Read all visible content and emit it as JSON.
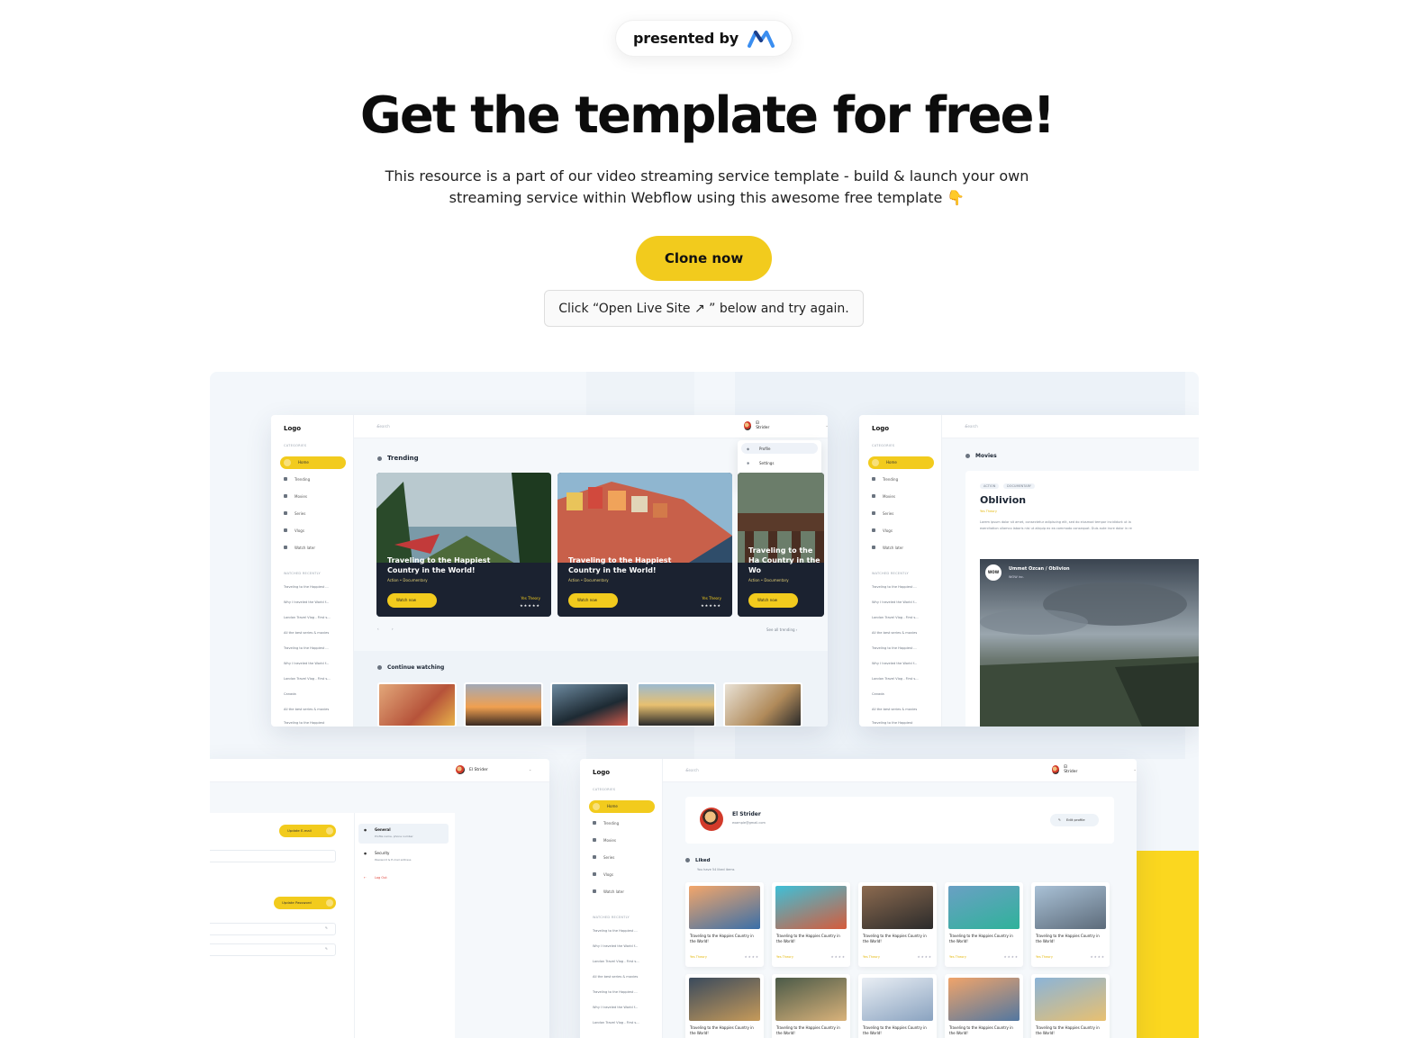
{
  "hero": {
    "presented_by": "presented by",
    "headline": "Get the template for free!",
    "subtext": "This resource is a part of our video streaming service template - build & launch your own streaming service within Webflow using this awesome free template 👇",
    "clone_button": "Clone now",
    "hint": "Click “Open Live Site ↗ ” below and try again."
  },
  "colors": {
    "accent": "#f2cb1d",
    "yellow_block": "#fbd71f",
    "dark_card": "#1b2230"
  },
  "app": {
    "logo": "Logo",
    "search": "Search",
    "categories_label": "CATEGORIES",
    "nav": [
      "Home",
      "Trending",
      "Movies",
      "Series",
      "Vlogs",
      "Watch later"
    ],
    "watched_label": "WATCHED RECENTLY",
    "recent": [
      "Traveling to the Happiest ...",
      "Why I traveled the World f...",
      "London Travel Vlog - First s...",
      "All the best series & movies",
      "Traveling to the Happiest ...",
      "Why I traveled the World f...",
      "London Travel Vlog - First s...",
      "Canada",
      "All the best series & movies",
      "Traveling to the Happiest"
    ],
    "user": "El Strider",
    "user_menu": [
      "Profile",
      "Settings",
      "Log Out"
    ]
  },
  "screen_trending": {
    "section": "Trending",
    "cards": [
      {
        "title": "Traveling to the Happiest Country in the World!",
        "meta": "Action • Documentary",
        "button": "Watch now",
        "channel": "Yes Theory",
        "stars": "★★★★★"
      },
      {
        "title": "Traveling to the Happiest Country in the World!",
        "meta": "Action • Documentary",
        "button": "Watch now",
        "channel": "Yes Theory",
        "stars": "★★★★★"
      },
      {
        "title": "Traveling to the Ha Country in the Wo",
        "meta": "Action • Documentary",
        "button": "Watch now",
        "channel": "",
        "stars": ""
      }
    ],
    "see_all": "See all trending  ›",
    "continue": "Continue watching"
  },
  "screen_movie": {
    "section": "Movies",
    "tags": [
      "ACTION",
      "DOCUMENTARY"
    ],
    "title": "Oblivion",
    "channel": "Yes Theory",
    "desc_line1": "Lorem ipsum dolor sit amet, consectetur adipiscing elit, sed do eiusmod tempor incididunt ut la",
    "desc_line2": "exercitation ullamco laboris nisi ut aliquip ex ea commodo consequat. Duis aute irure dolor in re",
    "video_title": "Ummet Ozcan / Oblivion",
    "video_sub": "WOW inc.",
    "video_badge": "WOW"
  },
  "screen_settings": {
    "update_email": "Update E-mail",
    "update_password": "Update Password",
    "menu": [
      {
        "title": "General",
        "sub": "Profile name, phone number"
      },
      {
        "title": "Security",
        "sub": "Password & E-mail address"
      }
    ],
    "logout": "Log Out"
  },
  "screen_profile": {
    "name": "El Strider",
    "email": "example@gmail.com",
    "edit": "Edit profile",
    "liked": "Liked",
    "liked_sub": "You have 54 liked items",
    "items": [
      {
        "title": "Traveling to the Happies Country in the World!",
        "channel": "Yes Theory",
        "stars": "★★★★",
        "c1": "#f3a66a",
        "c2": "#3a6fa8"
      },
      {
        "title": "Traveling to the Happies Country in the World!",
        "channel": "Yes Theory",
        "stars": "★★★★",
        "c1": "#3ec0d8",
        "c2": "#d65b3b"
      },
      {
        "title": "Traveling to the Happies Country in the World!",
        "channel": "Yes Theory",
        "stars": "★★★★",
        "c1": "#8c6a4f",
        "c2": "#2b2b2b"
      },
      {
        "title": "Traveling to the Happies Country in the World!",
        "channel": "Yes Theory",
        "stars": "★★★★",
        "c1": "#6aa0c4",
        "c2": "#2fb29a"
      },
      {
        "title": "Traveling to the Happies Country in the World!",
        "channel": "Yes Theory",
        "stars": "★★★★",
        "c1": "#a9c1d6",
        "c2": "#5d6b7a"
      },
      {
        "title": "Traveling to the Happies Country in the World!",
        "channel": "",
        "stars": "",
        "c1": "#3a4a5c",
        "c2": "#c69a5a"
      },
      {
        "title": "Traveling to the Happies Country in the World!",
        "channel": "",
        "stars": "",
        "c1": "#4b5a48",
        "c2": "#d9b27a"
      },
      {
        "title": "Traveling to the Happies Country in the World!",
        "channel": "",
        "stars": "",
        "c1": "#e9eef4",
        "c2": "#8aa3c0"
      },
      {
        "title": "Traveling to the Happies Country in the World!",
        "channel": "",
        "stars": "",
        "c1": "#f0a46a",
        "c2": "#5277a0"
      },
      {
        "title": "Traveling to the Happies Country in the World!",
        "channel": "",
        "stars": "",
        "c1": "#8bb4d8",
        "c2": "#e8c070"
      }
    ]
  }
}
